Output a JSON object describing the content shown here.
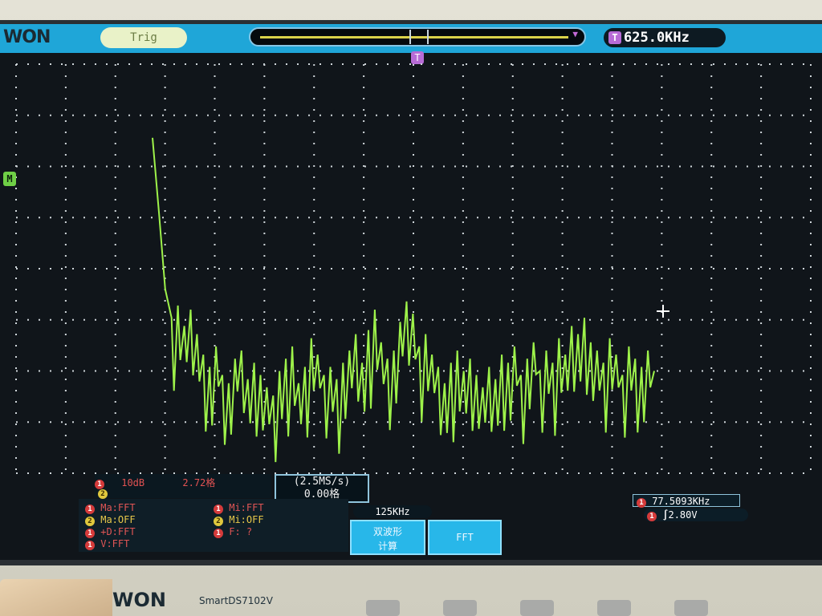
{
  "header": {
    "brand": "WON",
    "trig_label": "Trig",
    "trigger_marker": "T",
    "frequency_label": "625.0KHz"
  },
  "channels": {
    "math_marker": "M",
    "ch1_marker": "1",
    "ch2_marker": "2"
  },
  "readouts": {
    "ch1_scale": "10dB",
    "ch1_offset": "2.72格",
    "sample_rate": "(2.5MS/s)",
    "sample_offset": "0.00格",
    "measure_freq": "77.5093KHz",
    "trigger_level": "2.80V",
    "timebase": "125KHz"
  },
  "measurements": [
    {
      "ch": "1",
      "text": "Ma:FFT"
    },
    {
      "ch": "2",
      "text": "Ma:OFF"
    },
    {
      "ch": "1",
      "text": "+D:FFT"
    },
    {
      "ch": "1",
      "text": "V:FFT"
    },
    {
      "ch": "1",
      "text": "Mi:FFT"
    },
    {
      "ch": "2",
      "text": "Mi:OFF"
    },
    {
      "ch": "1",
      "text": "F:  ?"
    }
  ],
  "menu": {
    "button1_line1": "双波形",
    "button1_line2": "计算",
    "button2": "FFT"
  },
  "bezel": {
    "brand": "WON",
    "model": "SmartDS7102V"
  },
  "colors": {
    "trace": "#9ef24a",
    "screen_bg": "#10151a",
    "topbar": "#1fa6d8"
  },
  "chart_data": {
    "type": "line",
    "title": "",
    "xlabel": "",
    "ylabel": "",
    "grid": true,
    "series": [
      {
        "values": [
          82,
          64,
          45,
          38,
          41,
          36,
          40,
          34,
          29,
          26,
          31,
          24,
          22,
          28,
          30,
          23,
          27,
          24,
          21,
          19,
          25,
          28,
          31,
          22,
          26,
          33,
          29,
          24,
          26,
          23,
          27,
          30,
          34,
          27,
          35,
          40,
          32,
          28,
          30,
          37,
          42,
          39,
          31,
          34,
          29,
          26,
          22,
          27,
          30,
          25,
          28,
          24,
          21,
          26,
          23,
          29,
          27,
          31,
          24,
          28,
          32,
          25,
          30,
          27,
          33,
          29,
          36,
          34,
          38,
          32,
          30,
          27,
          33,
          29,
          24,
          31,
          28,
          26,
          30,
          25
        ]
      }
    ],
    "y_range": [
      0,
      100
    ]
  }
}
